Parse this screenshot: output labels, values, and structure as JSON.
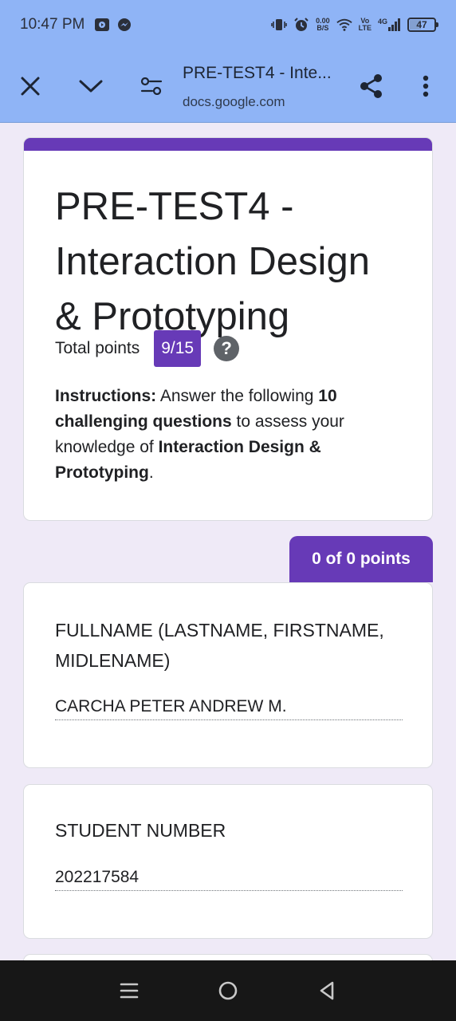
{
  "status_bar": {
    "time": "10:47 PM",
    "speed_value": "0.00",
    "speed_unit": "B/S",
    "volte_top": "Vo",
    "volte_bottom": "LTE",
    "network": "4G",
    "battery": "47",
    "battery_level": 0.47
  },
  "toolbar": {
    "page_title": "PRE-TEST4 - Inte...",
    "url": "docs.google.com"
  },
  "form": {
    "title": "PRE-TEST4 - Interaction Design & Prototyping",
    "total_points_label": "Total points",
    "total_points_value": "9/15",
    "help_symbol": "?",
    "instructions": {
      "p1_bold": "Instructions:",
      "p2": " Answer the following ",
      "p3_bold": "10 challenging questions",
      "p4": " to assess your knowledge of ",
      "p5_bold": "Interaction Design & Prototyping",
      "p6": "."
    },
    "section_score": "0 of 0 points",
    "questions": [
      {
        "label": "FULLNAME (LASTNAME, FIRSTNAME, MIDLENAME)",
        "answer": "CARCHA PETER ANDREW M."
      },
      {
        "label": "STUDENT NUMBER",
        "answer": "202217584"
      }
    ]
  },
  "colors": {
    "accent": "#673ab7",
    "toolbar_bg": "#8fb4f6",
    "page_bg": "#efeaf7"
  },
  "icons": {
    "close": "close-icon",
    "collapse": "chevron-down-icon",
    "tune": "tune-icon",
    "share": "share-icon",
    "more": "more-vert-icon",
    "nav_menu": "menu-icon",
    "nav_home": "home-circle-icon",
    "nav_back": "back-triangle-icon"
  }
}
